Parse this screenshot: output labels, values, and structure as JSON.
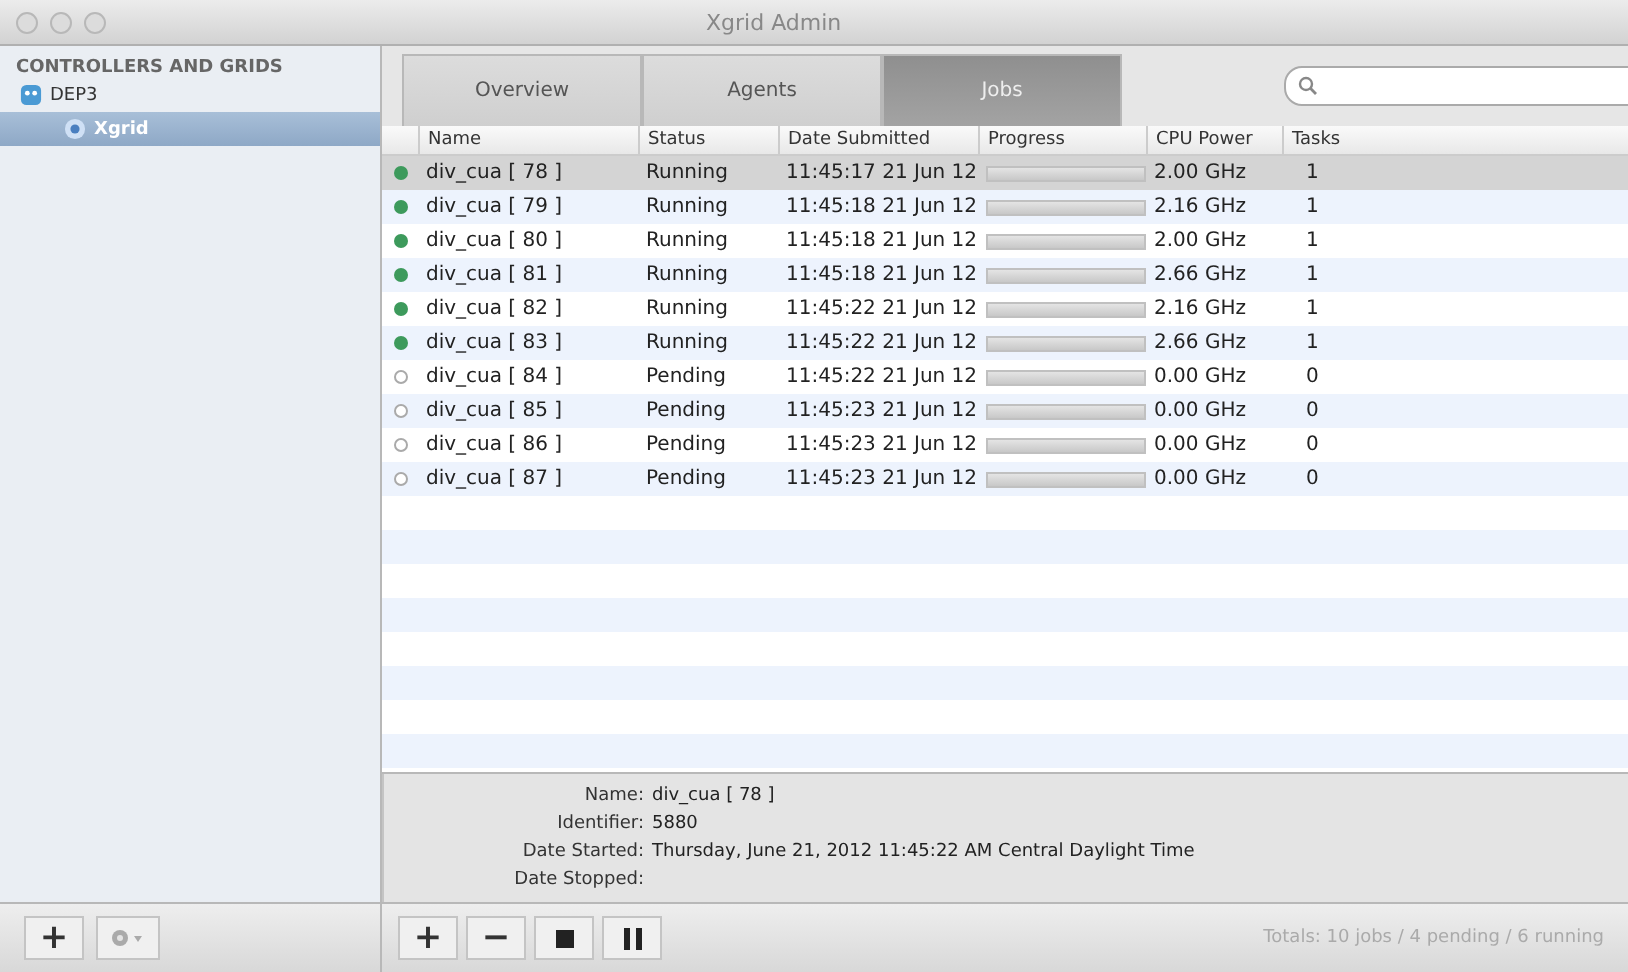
{
  "window": {
    "title": "Xgrid Admin"
  },
  "sidebar": {
    "heading": "CONTROLLERS AND GRIDS",
    "items": [
      {
        "label": "DEP3",
        "selected": false,
        "children": [
          {
            "label": "Xgrid",
            "selected": true
          }
        ]
      }
    ]
  },
  "tabs": [
    {
      "label": "Overview",
      "selected": false
    },
    {
      "label": "Agents",
      "selected": false
    },
    {
      "label": "Jobs",
      "selected": true
    }
  ],
  "table": {
    "columns": [
      "Name",
      "Status",
      "Date Submitted",
      "Progress",
      "CPU Power",
      "Tasks"
    ],
    "rows": [
      {
        "kind": "running",
        "name": "div_cua [ 78 ]",
        "status": "Running",
        "date": "11:45:17 21 Jun 12",
        "cpu": "2.00 GHz",
        "tasks": "1",
        "selected": true
      },
      {
        "kind": "running",
        "name": "div_cua [ 79 ]",
        "status": "Running",
        "date": "11:45:18 21 Jun 12",
        "cpu": "2.16 GHz",
        "tasks": "1",
        "selected": false
      },
      {
        "kind": "running",
        "name": "div_cua [ 80 ]",
        "status": "Running",
        "date": "11:45:18 21 Jun 12",
        "cpu": "2.00 GHz",
        "tasks": "1",
        "selected": false
      },
      {
        "kind": "running",
        "name": "div_cua [ 81 ]",
        "status": "Running",
        "date": "11:45:18 21 Jun 12",
        "cpu": "2.66 GHz",
        "tasks": "1",
        "selected": false
      },
      {
        "kind": "running",
        "name": "div_cua [ 82 ]",
        "status": "Running",
        "date": "11:45:22 21 Jun 12",
        "cpu": "2.16 GHz",
        "tasks": "1",
        "selected": false
      },
      {
        "kind": "running",
        "name": "div_cua [ 83 ]",
        "status": "Running",
        "date": "11:45:22 21 Jun 12",
        "cpu": "2.66 GHz",
        "tasks": "1",
        "selected": false
      },
      {
        "kind": "pending",
        "name": "div_cua [ 84 ]",
        "status": "Pending",
        "date": "11:45:22 21 Jun 12",
        "cpu": "0.00 GHz",
        "tasks": "0",
        "selected": false
      },
      {
        "kind": "pending",
        "name": "div_cua [ 85 ]",
        "status": "Pending",
        "date": "11:45:23 21 Jun 12",
        "cpu": "0.00 GHz",
        "tasks": "0",
        "selected": false
      },
      {
        "kind": "pending",
        "name": "div_cua [ 86 ]",
        "status": "Pending",
        "date": "11:45:23 21 Jun 12",
        "cpu": "0.00 GHz",
        "tasks": "0",
        "selected": false
      },
      {
        "kind": "pending",
        "name": "div_cua [ 87 ]",
        "status": "Pending",
        "date": "11:45:23 21 Jun 12",
        "cpu": "0.00 GHz",
        "tasks": "0",
        "selected": false
      }
    ]
  },
  "details": [
    {
      "label": "Name:",
      "value": "div_cua [ 78 ]"
    },
    {
      "label": "Identifier:",
      "value": "5880"
    },
    {
      "label": "Date Started:",
      "value": "Thursday, June 21, 2012 11:45:22 AM Central Daylight Time"
    },
    {
      "label": "Date Stopped:"
    }
  ],
  "sidebar_buttons": [
    {
      "label": "+",
      "disabled": false
    }
  ],
  "job_buttons": [
    {
      "kind": "text",
      "label": "+"
    },
    {
      "kind": "text",
      "label": "−"
    },
    {
      "kind": "stop"
    },
    {
      "kind": "pause"
    }
  ],
  "status_bar": {
    "totals": "Totals: 10 jobs / 4 pending / 6 running"
  }
}
